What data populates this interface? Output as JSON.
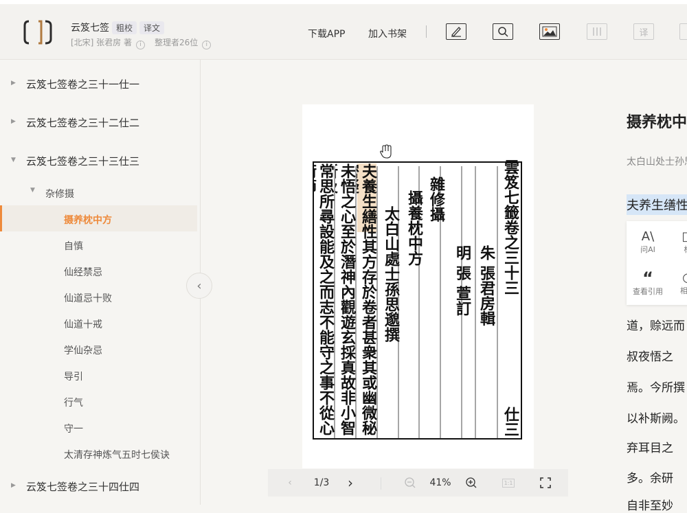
{
  "header": {
    "book_title": "云笈七签",
    "tags": [
      "粗校",
      "译文"
    ],
    "author": "[北宋] 张君房 著",
    "organizers": "整理者26位",
    "download_app": "下载APP",
    "add_shelf": "加入书架",
    "translate_label": "译"
  },
  "sidebar": {
    "items": [
      {
        "label": "云笈七签卷之三十一仕一"
      },
      {
        "label": "云笈七签卷之三十二仕二"
      },
      {
        "label": "云笈七签卷之三十三仕三"
      },
      {
        "label": "云笈七签卷之三十四仕四"
      }
    ],
    "group": "杂修摄",
    "subitems": [
      "摄养枕中方",
      "自慎",
      "仙经禁忌",
      "仙道忌十败",
      "仙道十戒",
      "学仙杂忌",
      "导引",
      "行气",
      "守一",
      "太清存神炼气五时七侯诀"
    ]
  },
  "viewer": {
    "page_indicator": "1/3",
    "zoom": "41%",
    "one_to_one": "1:1",
    "scan_text": {
      "col1_head": "雲笈七籤卷之三十三",
      "col1_tail": "仕三",
      "col2": "朱 張君房輯",
      "col3": "明 張 萱訂",
      "col4": "雜修攝",
      "col5": "攝養枕中方",
      "col6": "太白山處士孫思邈撰",
      "col7_hl": "夫養生繕性",
      "col7": "其方存於卷者甚衆其或幽微秘密疑",
      "col8": "未悟之心至於潛神內觀遊玄採真故非小智所及",
      "col9": "常思所尋設能及之而志不能守之事不從心術節"
    }
  },
  "article": {
    "title": "摄养枕中方",
    "author_line": "太白山处士孙思邈撰",
    "highlight": "夫养生缮性",
    "popup": [
      {
        "icon": "A\\",
        "label": "问AI"
      },
      {
        "icon": "□",
        "label": "标"
      },
      {
        "icon": "“",
        "label": "查看引用"
      },
      {
        "icon": "○",
        "label": "相似"
      }
    ],
    "lines": [
      "道，赊远而",
      "叔夜悟之",
      "焉。今所撰",
      "以补斯阙。",
      "弃耳目之",
      "多。余研",
      "自非至妙"
    ]
  },
  "colors": {
    "accent": "#ee8a3b",
    "highlight": "#d6e6f7"
  }
}
